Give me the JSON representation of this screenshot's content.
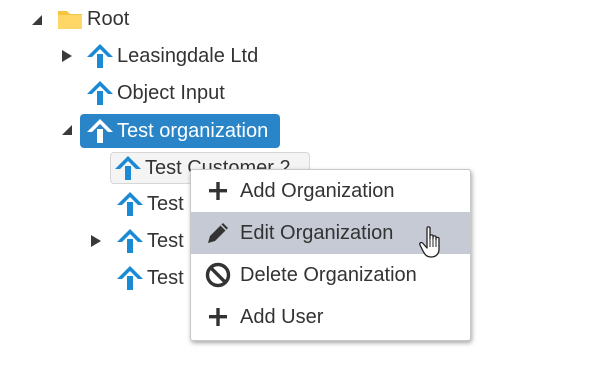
{
  "tree": {
    "root": {
      "label": "Root",
      "icon": "folder-icon",
      "expanded": true
    },
    "nodes": [
      {
        "label": "Leasingdale Ltd",
        "icon": "house-arrow-icon",
        "toggle": "collapsed"
      },
      {
        "label": "Object Input",
        "icon": "house-arrow-icon",
        "toggle": "none"
      },
      {
        "label": "Test organization",
        "icon": "house-arrow-icon",
        "toggle": "expanded",
        "selected": true
      },
      {
        "label": "Test Customer 2",
        "icon": "house-arrow-icon",
        "toggle": "none",
        "hovered": true
      },
      {
        "label": "Test",
        "icon": "house-arrow-icon",
        "toggle": "none"
      },
      {
        "label": "Test",
        "icon": "house-arrow-icon",
        "toggle": "collapsed"
      },
      {
        "label": "Test",
        "icon": "house-arrow-icon",
        "toggle": "none"
      }
    ]
  },
  "context_menu": {
    "items": [
      {
        "label": "Add Organization",
        "icon": "plus-icon"
      },
      {
        "label": "Edit Organization",
        "icon": "pencil-icon",
        "active": true
      },
      {
        "label": "Delete Organization",
        "icon": "ban-icon"
      },
      {
        "label": "Add User",
        "icon": "plus-icon"
      }
    ]
  },
  "colors": {
    "selection": "#2a85c8",
    "menu_active": "#c5cad4",
    "org_icon": "#1a8ad4",
    "folder": "#f5c542"
  },
  "cursor": {
    "icon": "hand-pointer-icon"
  }
}
